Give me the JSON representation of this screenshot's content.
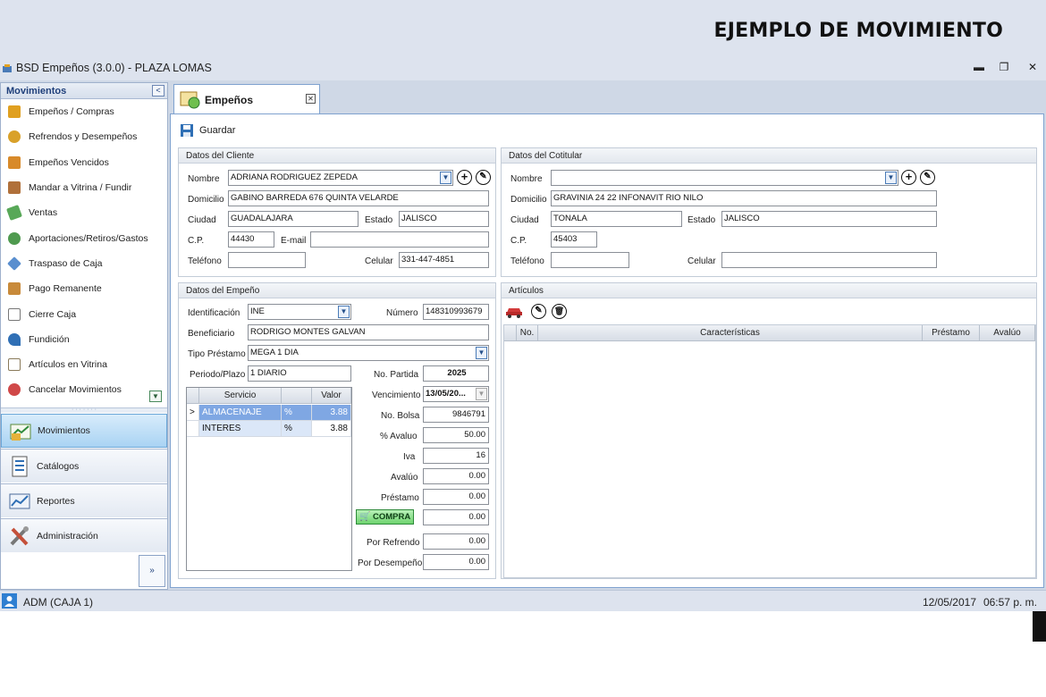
{
  "banner": {
    "title": "EJEMPLO DE MOVIMIENTO"
  },
  "window": {
    "title": "BSD Empeños (3.0.0) - PLAZA LOMAS",
    "minimize": "▬",
    "restore": "❐",
    "close": "✕"
  },
  "sidebar": {
    "header": "Movimientos",
    "collapse_glyph": "<",
    "items": [
      {
        "label": "Empeños / Compras",
        "icon": "pawn-icon",
        "color": "#e0a020"
      },
      {
        "label": "Refrendos y Desempeños",
        "icon": "coins-icon",
        "color": "#d9a12a"
      },
      {
        "label": "Empeños Vencidos",
        "icon": "expired-icon",
        "color": "#d88a2a"
      },
      {
        "label": "Mandar a Vitrina / Fundir",
        "icon": "vitrina-icon",
        "color": "#b0703a"
      },
      {
        "label": "Ventas",
        "icon": "sales-icon",
        "color": "#58a858"
      },
      {
        "label": "Aportaciones/Retiros/Gastos",
        "icon": "money-icon",
        "color": "#4f9a4f"
      },
      {
        "label": "Traspaso de Caja",
        "icon": "transfer-icon",
        "color": "#5a8fcf"
      },
      {
        "label": "Pago Remanente",
        "icon": "payment-icon",
        "color": "#c88a3a"
      },
      {
        "label": "Cierre Caja",
        "icon": "register-icon",
        "color": "#777777"
      },
      {
        "label": "Fundición",
        "icon": "foundry-icon",
        "color": "#2f6fb5"
      },
      {
        "label": "Artículos en Vitrina",
        "icon": "showcase-icon",
        "color": "#8a7a5a"
      },
      {
        "label": "Cancelar Movimientos",
        "icon": "cancel-icon",
        "color": "#d04848"
      }
    ],
    "grip": "· · · · · · ·",
    "sections": [
      {
        "label": "Movimientos",
        "active": true
      },
      {
        "label": "Catálogos",
        "active": false
      },
      {
        "label": "Reportes",
        "active": false
      },
      {
        "label": "Administración",
        "active": false
      }
    ],
    "expand_glyph": "»"
  },
  "tab": {
    "label": "Empeños",
    "close": "✕"
  },
  "toolbar": {
    "save_label": "Guardar"
  },
  "cliente": {
    "title": "Datos del Cliente",
    "nombre_label": "Nombre",
    "nombre": "ADRIANA RODRIGUEZ ZEPEDA",
    "domicilio_label": "Domicilio",
    "domicilio": "GABINO BARREDA 676 QUINTA VELARDE",
    "ciudad_label": "Ciudad",
    "ciudad": "GUADALAJARA",
    "estado_label": "Estado",
    "estado": "JALISCO",
    "cp_label": "C.P.",
    "cp": "44430",
    "email_label": "E-mail",
    "email": "",
    "telefono_label": "Teléfono",
    "telefono": "",
    "celular_label": "Celular",
    "celular": "331-447-4851"
  },
  "cotitular": {
    "title": "Datos del Cotitular",
    "nombre_label": "Nombre",
    "nombre": "",
    "domicilio_label": "Domicilio",
    "domicilio": "GRAVINIA 24 22 INFONAVIT RIO NILO",
    "ciudad_label": "Ciudad",
    "ciudad": "TONALA",
    "estado_label": "Estado",
    "estado": "JALISCO",
    "cp_label": "C.P.",
    "cp": "45403",
    "telefono_label": "Teléfono",
    "telefono": "",
    "celular_label": "Celular",
    "celular": ""
  },
  "empeno": {
    "title": "Datos del Empeño",
    "identificacion_label": "Identificación",
    "identificacion": "INE",
    "numero_label": "Número",
    "numero": "148310993679",
    "beneficiario_label": "Beneficiario",
    "beneficiario": "RODRIGO MONTES GALVAN",
    "tipo_label": "Tipo Préstamo",
    "tipo": "MEGA 1 DIA",
    "periodo_label": "Periodo/Plazo",
    "periodo": "1 DIARIO",
    "partida_label": "No. Partida",
    "partida": "2025",
    "vencimiento_label": "Vencimiento",
    "vencimiento": "13/05/20...",
    "bolsa_label": "No. Bolsa",
    "bolsa": "9846791",
    "avaluo_pct_label": "% Avaluo",
    "avaluo_pct": "50.00",
    "iva_label": "Iva",
    "iva": "16",
    "avaluo_label": "Avalúo",
    "avaluo": "0.00",
    "prestamo_label": "Préstamo",
    "prestamo": "0.00",
    "compra_label": "COMPRA",
    "compra": "0.00",
    "refrendo_label": "Por Refrendo",
    "refrendo": "0.00",
    "desempeno_label": "Por Desempeño",
    "desempeno": "0.00",
    "servicios": {
      "headers": [
        "Servicio",
        "",
        "Valor"
      ],
      "rows": [
        {
          "marker": ">",
          "servicio": "ALMACENAJE",
          "tipo": "%",
          "valor": "3.88"
        },
        {
          "marker": "",
          "servicio": "INTERES",
          "tipo": "%",
          "valor": "3.88"
        }
      ]
    }
  },
  "articulos": {
    "title": "Artículos",
    "headers": [
      "No.",
      "Características",
      "Préstamo",
      "Avalúo"
    ],
    "rows": []
  },
  "status": {
    "user": "ADM (CAJA 1)",
    "date": "12/05/2017",
    "time": "06:57 p. m."
  }
}
